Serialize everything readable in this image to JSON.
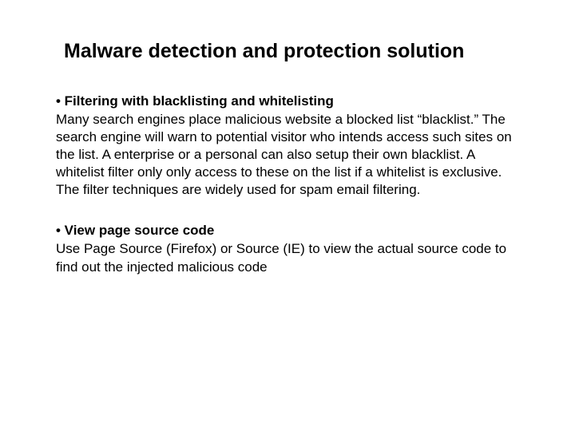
{
  "title": "Malware detection and protection solution",
  "sections": [
    {
      "bullet": "• Filtering with blacklisting and whitelisting",
      "body": "Many search engines place malicious website a blocked list “blacklist.” The search engine will warn to potential visitor who intends access such sites on the list. A enterprise or a personal can also setup their own blacklist. A whitelist filter only only access to these on the list if a whitelist is exclusive. The filter techniques are widely used for spam email filtering."
    },
    {
      "bullet": "• View page source code",
      "body": "Use Page Source (Firefox) or Source (IE) to view the actual source code to find out the injected malicious code"
    }
  ]
}
